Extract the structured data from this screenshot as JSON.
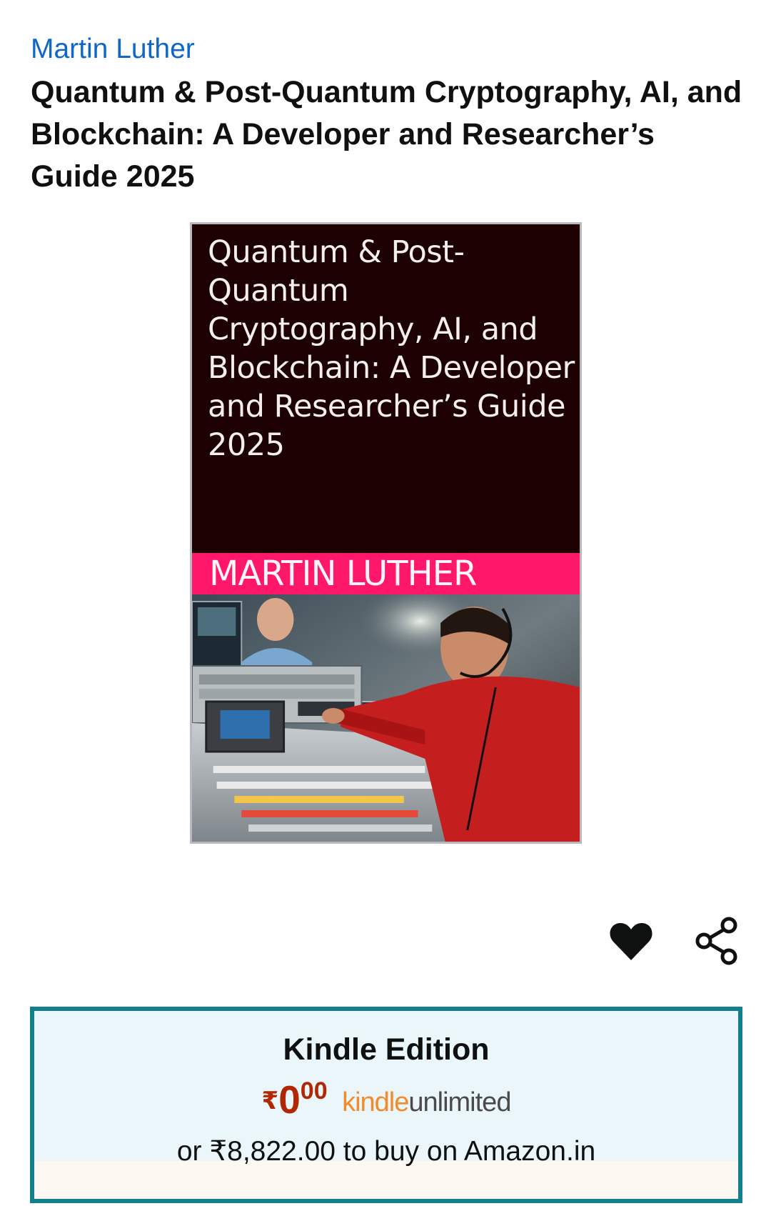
{
  "product": {
    "author": "Martin Luther",
    "title": "Quantum & Post-Quantum Cryptography, AI, and Blockchain: A Developer and Researcher’s Guide 2025"
  },
  "cover": {
    "title_lines": [
      "Quantum & Post-",
      "Quantum",
      "Cryptography, AI, and",
      "Blockchain: A Developer",
      "and Researcher’s Guide",
      "2025"
    ],
    "author": "MARTIN LUTHER"
  },
  "actions": {
    "wishlist_icon": "heart-icon",
    "share_icon": "share-icon"
  },
  "offer": {
    "edition": "Kindle Edition",
    "price_symbol": "₹",
    "price_whole": "0",
    "price_fraction": "00",
    "program_part1": "kindle",
    "program_part2": "unlimited",
    "buy_text": "or ₹8,822.00 to buy on Amazon.in"
  },
  "colors": {
    "link": "#0f68c8",
    "price": "#b12704",
    "box_border": "#127f8c",
    "box_bg": "#ebf6fb",
    "cover_bg": "#1c0002",
    "cover_band": "#ff1769",
    "kindle_orange": "#f38b28"
  }
}
